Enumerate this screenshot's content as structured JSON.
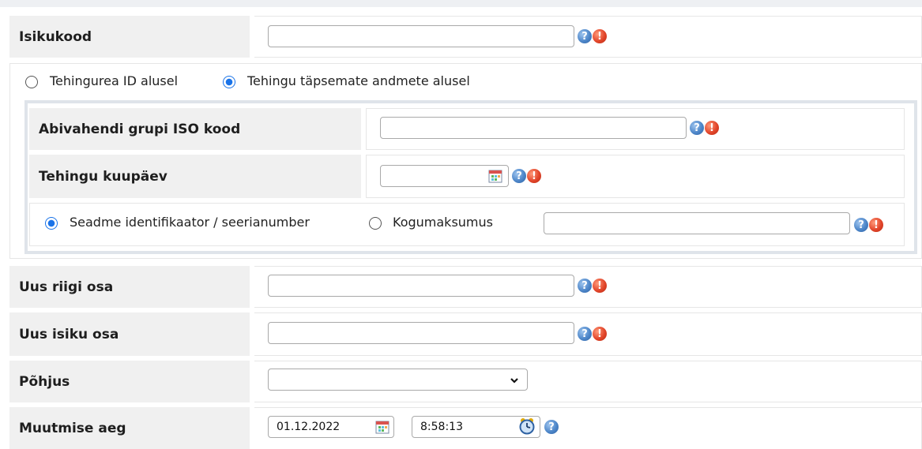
{
  "fields": {
    "isikukood": {
      "label": "Isikukood",
      "value": ""
    },
    "search_mode": {
      "option_id_label": "Tehingurea ID alusel",
      "option_details_label": "Tehingu täpsemate andmete alusel",
      "selected": "details"
    },
    "iso_kood": {
      "label": "Abivahendi grupi ISO kood",
      "value": ""
    },
    "kuupaev": {
      "label": "Tehingu kuupäev",
      "value": ""
    },
    "identifier_mode": {
      "option_serial_label": "Seadme identifikaator / seerianumber",
      "option_total_label": "Kogumaksumus",
      "selected": "serial",
      "value": ""
    },
    "uus_riigi_osa": {
      "label": "Uus riigi osa",
      "value": ""
    },
    "uus_isiku_osa": {
      "label": "Uus isiku osa",
      "value": ""
    },
    "pohjus": {
      "label": "Põhjus",
      "selected_value": ""
    },
    "muutmise_aeg": {
      "label": "Muutmise aeg",
      "date": "01.12.2022",
      "time": "8:58:13"
    }
  },
  "icons": {
    "help": "help-icon",
    "warning": "warning-icon",
    "calendar": "calendar-icon",
    "clock": "clock-icon",
    "dropdown": "chevron-down-icon"
  },
  "colors": {
    "label_bg": "#f0f0f0",
    "frame": "#dfe4ea",
    "radio_accent": "#1a73e8",
    "help_blue": "#4d86c9",
    "warning_red": "#e2452a"
  }
}
